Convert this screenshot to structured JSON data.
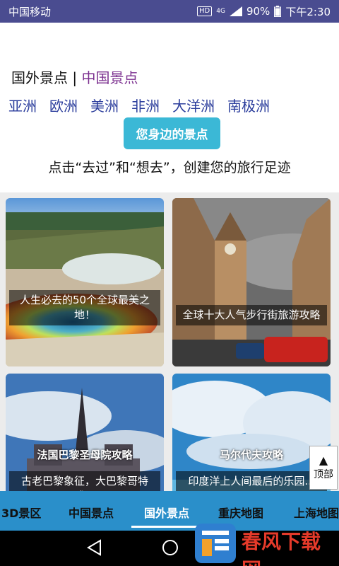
{
  "status": {
    "carrier": "中国移动",
    "hd": "HD",
    "network": "4G",
    "battery": "90%",
    "time": "下午2:30"
  },
  "header": {
    "tab_foreign": "国外景点",
    "separator": "|",
    "tab_china": "中国景点",
    "continents": [
      "亚洲",
      "欧洲",
      "美洲",
      "非洲",
      "大洋洲",
      "南极洲"
    ],
    "nearby_button": "您身边的景点",
    "hint": "点击“去过”和“想去”，创建您的旅行足迹"
  },
  "cards": [
    {
      "caption": "人生必去的50个全球最美之地！"
    },
    {
      "caption": "全球十大人气步行街旅游攻略"
    },
    {
      "image_text": "法国巴黎圣母院攻略",
      "caption": "古老巴黎象征，大巴黎哥特式..."
    },
    {
      "image_text": "马尔代夫攻略",
      "caption": "印度洋上人间最后的乐园..."
    }
  ],
  "back_to_top": {
    "arrow": "▲",
    "label": "顶部"
  },
  "bottom_tabs": [
    {
      "label": "3D景区"
    },
    {
      "label": "中国景点"
    },
    {
      "label": "国外景点",
      "active": true
    },
    {
      "label": "重庆地图"
    },
    {
      "label": "上海地图"
    }
  ],
  "watermark": {
    "text": "春风下载网"
  },
  "colors": {
    "status_bar": "#4a4c90",
    "accent_purple": "#7b2f8f",
    "continent_blue": "#2b3d9c",
    "button_cyan": "#3bb8d6",
    "bottom_bar": "#2a8fca"
  }
}
